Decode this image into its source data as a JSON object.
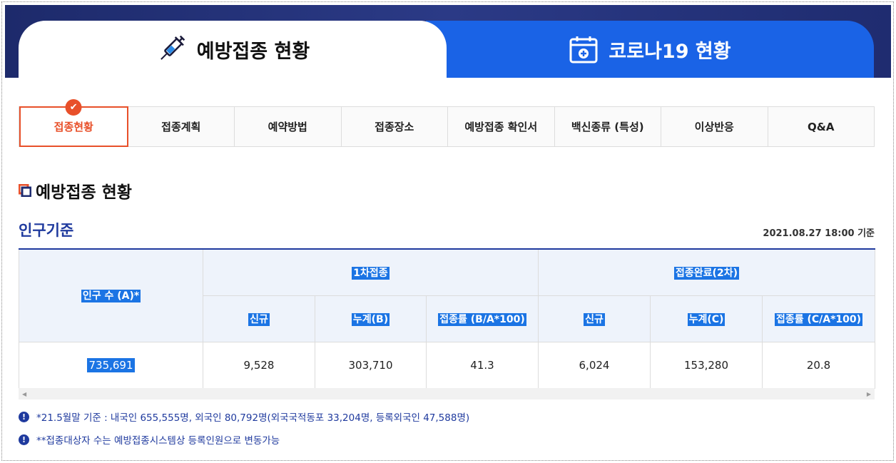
{
  "tabs": {
    "vaccination": "예방접종 현황",
    "corona": "코로나19 현황"
  },
  "subnav": [
    "접종현황",
    "접종계획",
    "예약방법",
    "접종장소",
    "예방접종 확인서",
    "백신종류 (특성)",
    "이상반응",
    "Q&A"
  ],
  "section_title": "예방접종 현황",
  "sub_title": "인구기준",
  "date": "2021.08.27 18:00 기준",
  "table": {
    "population_header": "인구 수 (A)*",
    "first_dose_header": "1차접종",
    "completed_header": "접종완료(2차)",
    "sub_headers": [
      "신규",
      "누계(B)",
      "접종률 (B/A*100)",
      "신규",
      "누계(C)",
      "접종률 (C/A*100)"
    ],
    "row": [
      "735,691",
      "9,528",
      "303,710",
      "41.3",
      "6,024",
      "153,280",
      "20.8"
    ]
  },
  "notes": [
    "*21.5월말 기준 : 내국인 655,555명, 외국인 80,792명(외국국적동포 33,204명, 등록외국인 47,588명)",
    "**접종대상자 수는 예방접종시스템상 등록인원으로 변동가능"
  ],
  "colors": {
    "accent": "#e8502a",
    "navy": "#1f3a9e",
    "blue": "#1a63e6"
  }
}
